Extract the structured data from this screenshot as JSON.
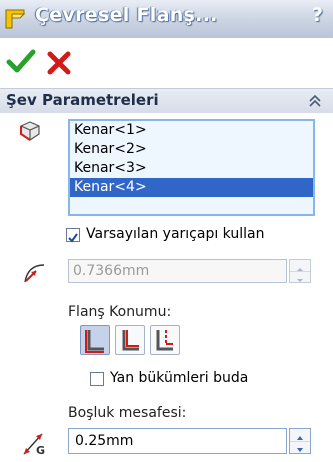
{
  "title": "Çevresel Flanş...",
  "help_label": "?",
  "section": {
    "title": "Şev Parametreleri"
  },
  "edges": [
    {
      "label": "Kenar<1>",
      "selected": false
    },
    {
      "label": "Kenar<2>",
      "selected": false
    },
    {
      "label": "Kenar<3>",
      "selected": false
    },
    {
      "label": "Kenar<4>",
      "selected": true
    }
  ],
  "use_default_radius": {
    "label": "Varsayılan yarıçapı kullan",
    "checked": true
  },
  "radius": {
    "value": "0.7366mm",
    "enabled": false
  },
  "flange_position": {
    "label": "Flanş Konumu:",
    "selected_index": 0
  },
  "trim_side_bends": {
    "label": "Yan bükümleri buda",
    "checked": false
  },
  "gap_distance": {
    "label": "Boşluk mesafesi:",
    "value": "0.25mm",
    "icon_letter": "G"
  },
  "colors": {
    "accent": "#2f66c8",
    "ok": "#2aa12a",
    "cancel": "#d11a1a"
  }
}
